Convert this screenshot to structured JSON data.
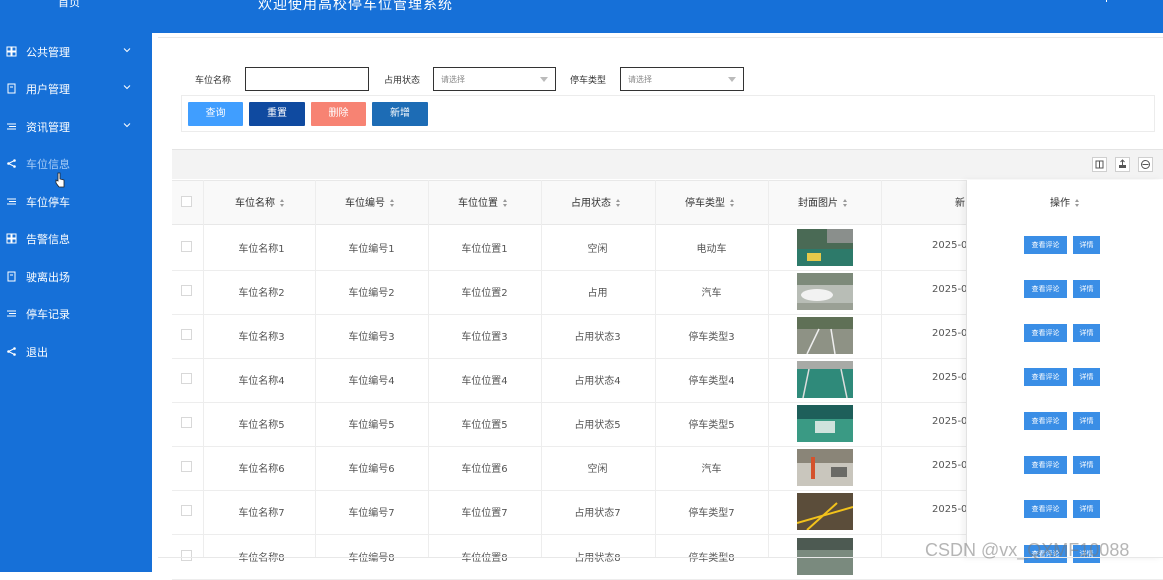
{
  "header": {
    "home_label": "首页",
    "title": "欢迎使用高校停车位管理系统"
  },
  "sidebar": {
    "items": [
      {
        "label": "公共管理",
        "icon": "grid-icon",
        "expandable": true
      },
      {
        "label": "用户管理",
        "icon": "book-icon",
        "expandable": true
      },
      {
        "label": "资讯管理",
        "icon": "list-icon",
        "expandable": true
      },
      {
        "label": "车位信息",
        "icon": "share-icon",
        "expandable": false,
        "active": true
      },
      {
        "label": "车位停车",
        "icon": "list-icon",
        "expandable": false
      },
      {
        "label": "告警信息",
        "icon": "grid-icon",
        "expandable": false
      },
      {
        "label": "驶离出场",
        "icon": "book-icon",
        "expandable": false
      },
      {
        "label": "停车记录",
        "icon": "list-icon",
        "expandable": false
      },
      {
        "label": "退出",
        "icon": "share-icon",
        "expandable": false
      }
    ]
  },
  "filters": {
    "name_label": "车位名称",
    "name_value": "",
    "status_label": "占用状态",
    "status_placeholder": "请选择",
    "type_label": "停车类型",
    "type_placeholder": "请选择"
  },
  "actions": {
    "query": "查询",
    "reset": "重置",
    "delete": "删除",
    "add": "新增"
  },
  "colors": {
    "header_bg": "#1670d8",
    "query_btn": "#409eff",
    "reset_btn": "#0f4aa0",
    "delete_btn": "#f78373",
    "add_btn": "#1d6cb5",
    "row_btn": "#3a8ee6"
  },
  "table": {
    "columns": [
      "车位名称",
      "车位编号",
      "车位位置",
      "占用状态",
      "停车类型",
      "封面图片",
      "新",
      "操作"
    ],
    "row_actions": {
      "reviews": "查看评论",
      "detail": "详情"
    },
    "rows": [
      {
        "name": "车位名称1",
        "code": "车位编号1",
        "location": "车位位置1",
        "status": "空闲",
        "type": "电动车",
        "date": "2025-0"
      },
      {
        "name": "车位名称2",
        "code": "车位编号2",
        "location": "车位位置2",
        "status": "占用",
        "type": "汽车",
        "date": "2025-0"
      },
      {
        "name": "车位名称3",
        "code": "车位编号3",
        "location": "车位位置3",
        "status": "占用状态3",
        "type": "停车类型3",
        "date": "2025-0"
      },
      {
        "name": "车位名称4",
        "code": "车位编号4",
        "location": "车位位置4",
        "status": "占用状态4",
        "type": "停车类型4",
        "date": "2025-0"
      },
      {
        "name": "车位名称5",
        "code": "车位编号5",
        "location": "车位位置5",
        "status": "占用状态5",
        "type": "停车类型5",
        "date": "2025-0"
      },
      {
        "name": "车位名称6",
        "code": "车位编号6",
        "location": "车位位置6",
        "status": "空闲",
        "type": "汽车",
        "date": "2025-0"
      },
      {
        "name": "车位名称7",
        "code": "车位编号7",
        "location": "车位位置7",
        "status": "占用状态7",
        "type": "停车类型7",
        "date": "2025-0"
      },
      {
        "name": "车位名称8",
        "code": "车位编号8",
        "location": "车位位置8",
        "status": "占用状态8",
        "type": "停车类型8",
        "date": ""
      }
    ]
  },
  "watermark": "CSDN @vx_QXMF10088"
}
